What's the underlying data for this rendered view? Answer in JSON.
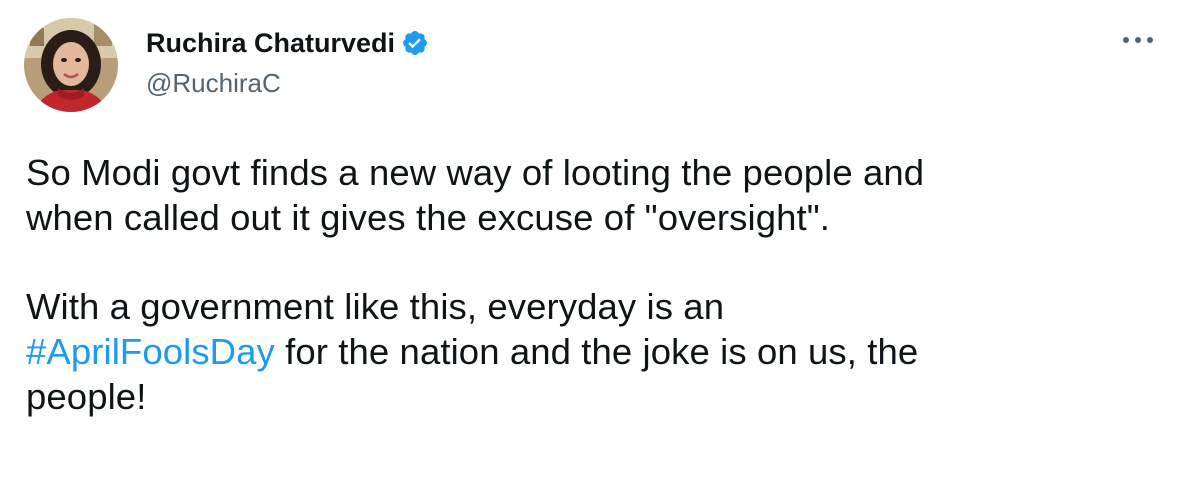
{
  "author": {
    "display_name": "Ruchira Chaturvedi",
    "handle": "@RuchiraC",
    "verified": true
  },
  "icons": {
    "verified": "verified-badge-icon",
    "more": "more-horizontal-icon"
  },
  "colors": {
    "text": "#0f1419",
    "secondary": "#536471",
    "link": "#1d9bf0",
    "verified": "#1d9bf0"
  },
  "tweet": {
    "line_1": "So Modi govt finds a new way of looting the people and",
    "line_2": "when called out it gives the excuse of \"oversight\".",
    "line_3": "With a government like this, everyday is an",
    "hashtag": "#AprilFoolsDay",
    "line_4_rest": " for the nation and the joke is on us, the",
    "line_5": "people!"
  }
}
